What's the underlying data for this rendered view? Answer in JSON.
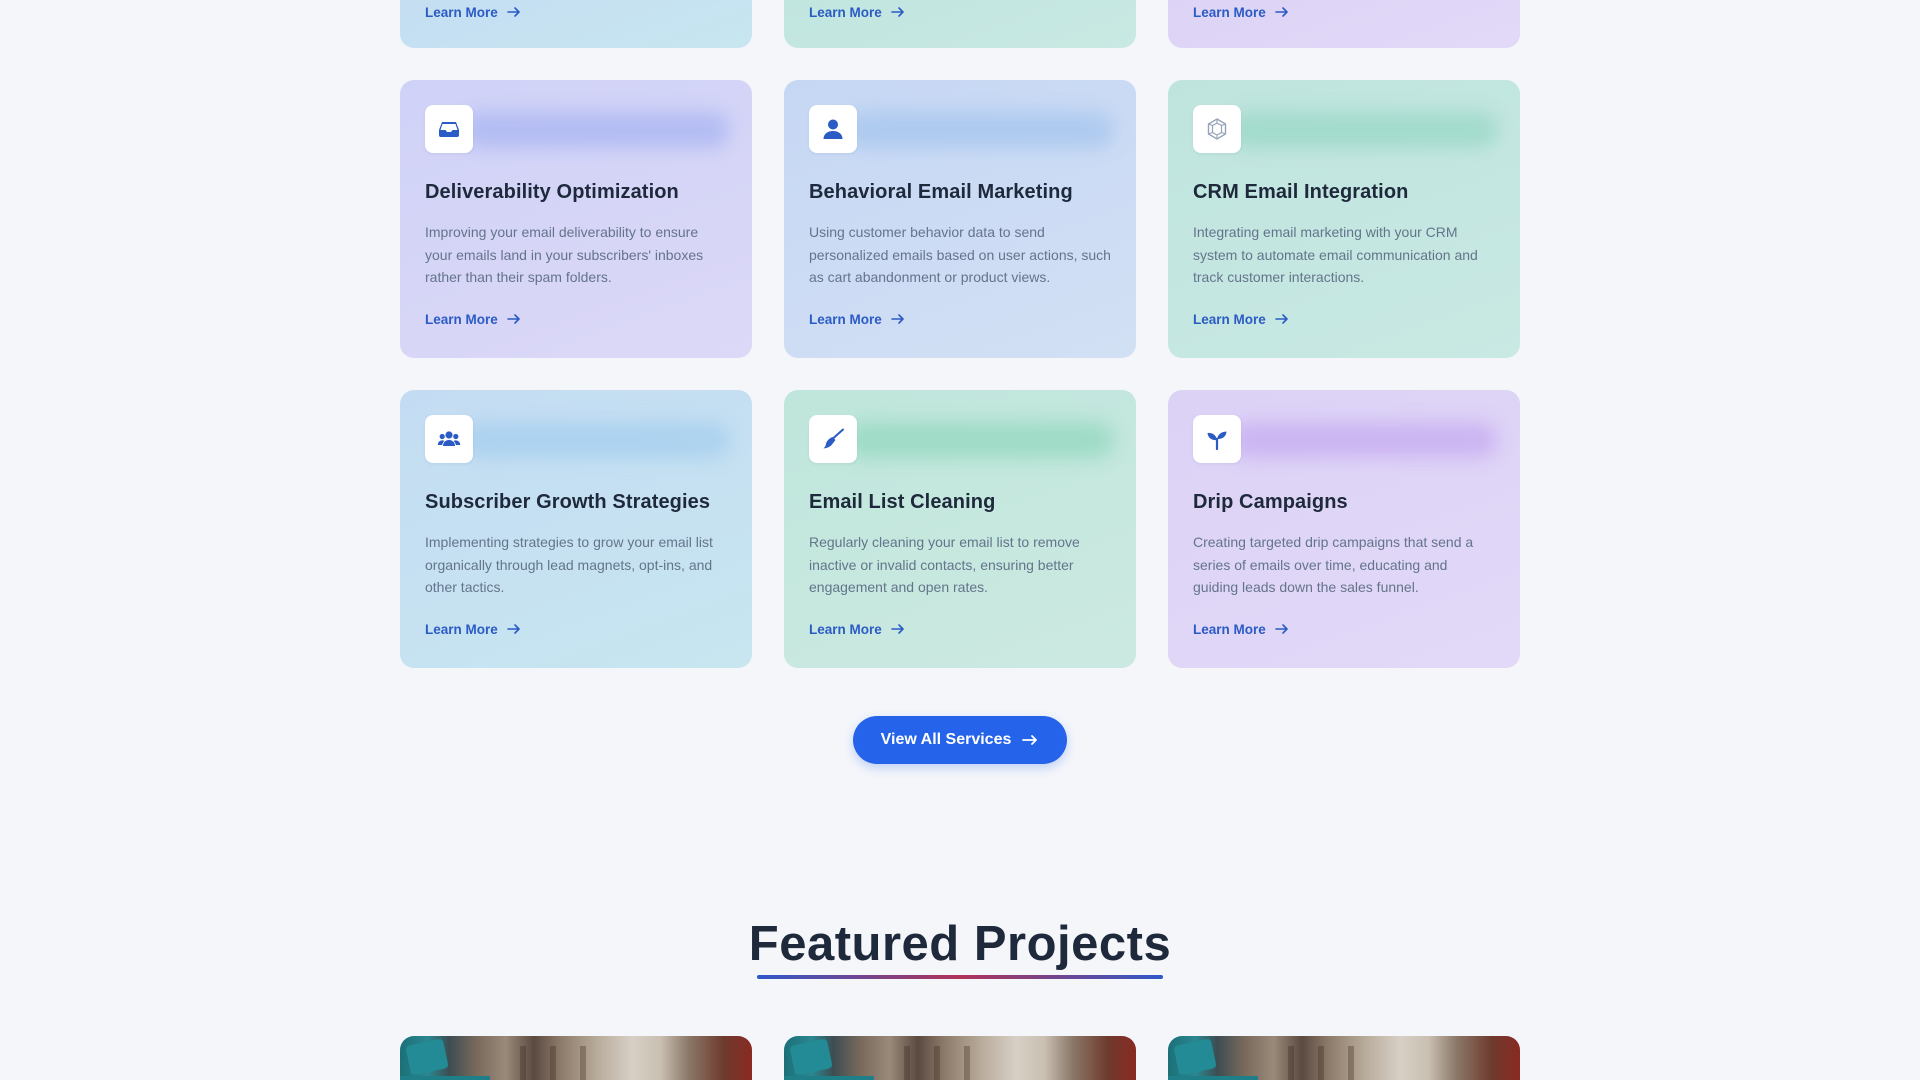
{
  "services": {
    "top_row": [
      {
        "theme": "blue",
        "learn_more": "Learn More"
      },
      {
        "theme": "teal",
        "learn_more": "Learn More"
      },
      {
        "theme": "violet",
        "learn_more": "Learn More"
      }
    ],
    "cards": [
      {
        "icon": "inbox-icon",
        "theme": "indigo",
        "title": "Deliverability Optimization",
        "description": "Improving your email deliverability to ensure your emails land in your subscribers' inboxes rather than their spam folders.",
        "learn_more": "Learn More"
      },
      {
        "icon": "user-icon",
        "theme": "sky",
        "title": "Behavioral Email Marketing",
        "description": "Using customer behavior data to send personalized emails based on user actions, such as cart abandonment or product views.",
        "learn_more": "Learn More"
      },
      {
        "icon": "hexagon-nodes-icon",
        "theme": "teal",
        "title": "CRM Email Integration",
        "description": "Integrating email marketing with your CRM system to automate email communication and track customer interactions.",
        "learn_more": "Learn More"
      },
      {
        "icon": "users-icon",
        "theme": "blue",
        "title": "Subscriber Growth Strategies",
        "description": "Implementing strategies to grow your email list organically through lead magnets, opt-ins, and other tactics.",
        "learn_more": "Learn More"
      },
      {
        "icon": "broom-icon",
        "theme": "mint",
        "title": "Email List Cleaning",
        "description": "Regularly cleaning your email list to remove inactive or invalid contacts, ensuring better engagement and open rates.",
        "learn_more": "Learn More"
      },
      {
        "icon": "seedling-icon",
        "theme": "violet",
        "title": "Drip Campaigns",
        "description": "Creating targeted drip campaigns that send a series of emails over time, educating and guiding leads down the sales funnel.",
        "learn_more": "Learn More"
      }
    ],
    "view_all_label": "View All Services"
  },
  "featured": {
    "title": "Featured Projects",
    "project_count_visible": 3
  },
  "colors": {
    "accent": "#2563eb",
    "link": "#2b5bc4",
    "heading": "#1e293b",
    "body_text": "#64748b",
    "page_bg": "#f4f6fa"
  }
}
